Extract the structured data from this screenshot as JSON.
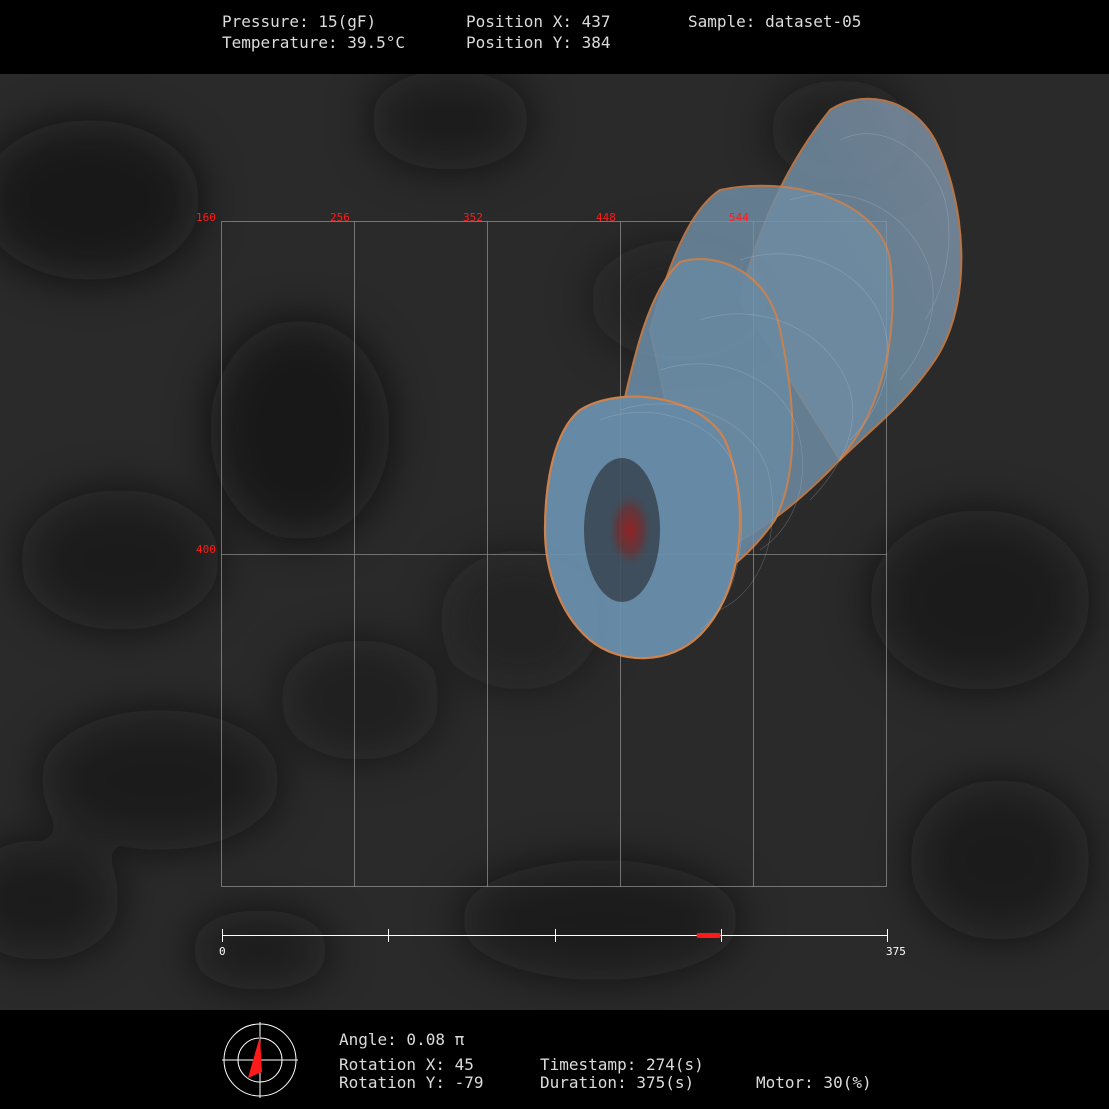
{
  "header": {
    "pressure": "Pressure: 15(gF)",
    "temperature": "Temperature: 39.5°C",
    "position_x": "Position X: 437",
    "position_y": "Position Y: 384",
    "sample": "Sample: dataset-05"
  },
  "grid": {
    "x_ticks": [
      "160",
      "256",
      "352",
      "448",
      "544"
    ],
    "y_tick": "400"
  },
  "timeline": {
    "start_label": "0",
    "end_label": "375",
    "current": 274,
    "duration": 375
  },
  "footer": {
    "angle": "Angle: 0.08 π",
    "rotation_x": "Rotation X: 45",
    "rotation_y": "Rotation Y: -79",
    "timestamp": "Timestamp: 274(s)",
    "duration": "Duration: 375(s)",
    "motor": "Motor: 30(%)"
  },
  "colors": {
    "accent": "#ff1a1a",
    "grid": "#9a9a9a",
    "shape_fill": "#6f98b4",
    "shape_edge": "#e08a4e"
  },
  "icons": {
    "compass": "compass-icon"
  }
}
